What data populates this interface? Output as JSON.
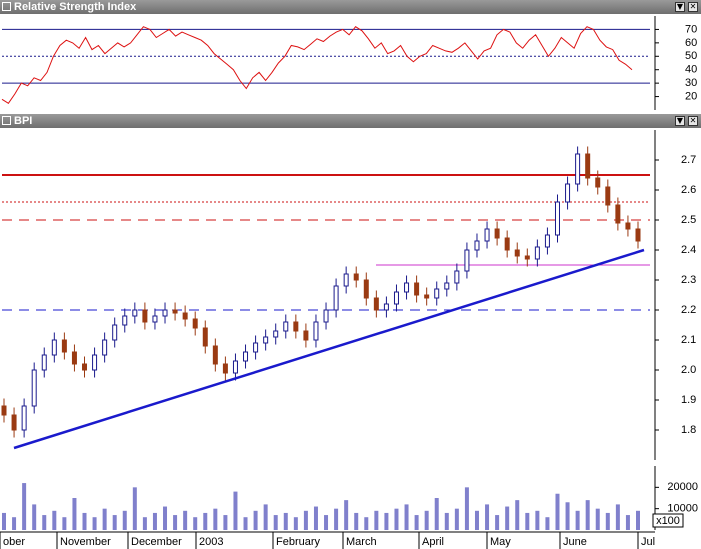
{
  "rsi_panel": {
    "title": "Relative Strength Index",
    "buttons": [
      "▼",
      "✕"
    ]
  },
  "price_panel": {
    "title": "BPI",
    "buttons": [
      "▼",
      "✕"
    ]
  },
  "volume_multiplier_label": "x100",
  "colors": {
    "up_candle": "#1a1a8c",
    "down_candle": "#9a3a12",
    "rsi_line": "#dd1111",
    "trendline": "#1a1acc",
    "resistance": "#cc1111",
    "support_dashed": "#1a1acc",
    "volume_bar": "#8080cc",
    "range_line": "#cc33cc"
  },
  "chart_data": [
    {
      "type": "line",
      "title": "Relative Strength Index",
      "ylim": [
        10,
        80
      ],
      "yticks": [
        20,
        30,
        40,
        50,
        60,
        70
      ],
      "reference_lines": [
        {
          "value": 70,
          "style": "solid"
        },
        {
          "value": 50,
          "style": "dotted"
        },
        {
          "value": 30,
          "style": "solid"
        }
      ],
      "series": [
        {
          "values": [
            18,
            15,
            22,
            30,
            28,
            34,
            32,
            38,
            50,
            58,
            62,
            60,
            56,
            64,
            55,
            58,
            52,
            56,
            60,
            57,
            60,
            66,
            72,
            70,
            64,
            67,
            70,
            65,
            68,
            66,
            64,
            62,
            58,
            52,
            48,
            44,
            40,
            32,
            26,
            34,
            38,
            32,
            38,
            45,
            50,
            58,
            57,
            55,
            59,
            63,
            61,
            65,
            68,
            70,
            66,
            72,
            69,
            63,
            56,
            60,
            52,
            54,
            58,
            50,
            46,
            50,
            52,
            58,
            56,
            54,
            53,
            56,
            60,
            54,
            48,
            54,
            56,
            66,
            70,
            68,
            60,
            56,
            62,
            66,
            58,
            50,
            56,
            64,
            60,
            56,
            67,
            72,
            70,
            62,
            57,
            55,
            47,
            44,
            40
          ]
        }
      ]
    },
    {
      "type": "candlestick",
      "title": "BPI",
      "ylim": [
        1.7,
        2.8
      ],
      "yticks": [
        1.8,
        1.9,
        2.0,
        2.1,
        2.2,
        2.3,
        2.4,
        2.5,
        2.6,
        2.7
      ],
      "x_labels": [
        "ober",
        "November",
        "December",
        "2003",
        "February",
        "March",
        "April",
        "May",
        "June",
        "Jul"
      ],
      "close": [
        1.85,
        1.8,
        1.88,
        2.0,
        2.05,
        2.1,
        2.06,
        2.02,
        2.0,
        2.05,
        2.1,
        2.15,
        2.18,
        2.2,
        2.16,
        2.18,
        2.2,
        2.19,
        2.17,
        2.14,
        2.08,
        2.02,
        1.99,
        2.03,
        2.06,
        2.09,
        2.11,
        2.13,
        2.16,
        2.13,
        2.1,
        2.16,
        2.2,
        2.28,
        2.32,
        2.3,
        2.24,
        2.2,
        2.22,
        2.26,
        2.29,
        2.25,
        2.24,
        2.27,
        2.29,
        2.33,
        2.4,
        2.43,
        2.47,
        2.44,
        2.4,
        2.38,
        2.37,
        2.41,
        2.45,
        2.56,
        2.62,
        2.72,
        2.64,
        2.61,
        2.55,
        2.49,
        2.47,
        2.43
      ],
      "reference_lines": [
        {
          "name": "resistance",
          "value": 2.65,
          "style": "solid"
        },
        {
          "value": 2.56,
          "style": "dotted"
        },
        {
          "value": 2.5,
          "style": "dashed"
        },
        {
          "value": 2.35,
          "style": "solid",
          "from_category": "March"
        },
        {
          "value": 2.2,
          "style": "dashed"
        }
      ],
      "trendline": {
        "from": 1.74,
        "to": 2.4
      }
    },
    {
      "type": "bar",
      "title": "Volume",
      "ylim": [
        0,
        300
      ],
      "yticks": [
        10000,
        20000
      ],
      "multiplier": "x100",
      "values": [
        80,
        60,
        220,
        120,
        70,
        90,
        60,
        150,
        80,
        60,
        100,
        70,
        90,
        200,
        60,
        80,
        110,
        70,
        90,
        60,
        80,
        100,
        70,
        180,
        60,
        90,
        120,
        70,
        80,
        60,
        90,
        110,
        70,
        100,
        140,
        80,
        60,
        90,
        80,
        100,
        120,
        70,
        90,
        150,
        80,
        100,
        200,
        90,
        120,
        70,
        110,
        140,
        80,
        90,
        60,
        170,
        130,
        90,
        140,
        100,
        80,
        120,
        70,
        90
      ]
    }
  ]
}
